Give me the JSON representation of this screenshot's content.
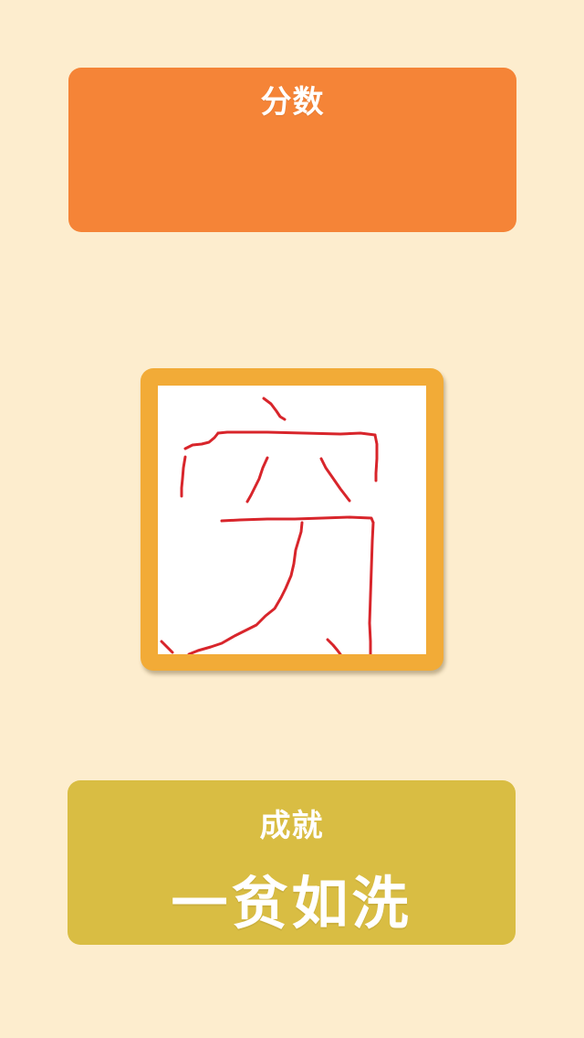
{
  "score": {
    "title": "分数",
    "value": ""
  },
  "drawing": {
    "description_icon": "hand-drawn-character",
    "stroke_color": "#d8252b"
  },
  "achievement": {
    "title": "成就",
    "value": "一贫如洗"
  },
  "colors": {
    "background": "#fdedce",
    "score_card": "#f58437",
    "frame": "#f2ab37",
    "achievement_card": "#d9bd43",
    "text": "#ffffff"
  }
}
